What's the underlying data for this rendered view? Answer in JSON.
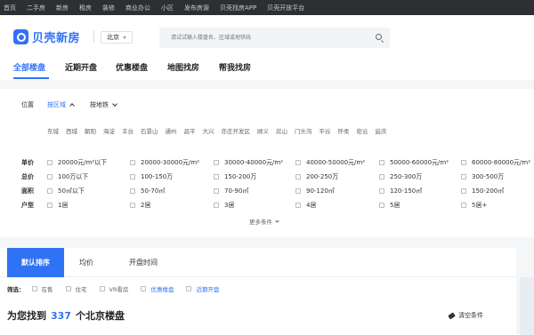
{
  "topbar": {
    "items": [
      "首页",
      "二手房",
      "新房",
      "租房",
      "装修",
      "商业办公",
      "小区",
      "发布房源",
      "贝壳找房APP",
      "贝壳开放平台"
    ]
  },
  "header": {
    "logo_text": "贝壳新房",
    "city": "北京",
    "search_placeholder": "请试试输入楼盘名、区域或地铁线"
  },
  "nav": {
    "items": [
      "全部楼盘",
      "近期开盘",
      "优惠楼盘",
      "地图找房",
      "帮我找房"
    ],
    "active_index": 0
  },
  "filter": {
    "position": {
      "label": "位置",
      "by_district": "按区域",
      "by_subway": "按地铁"
    },
    "districts": [
      "东城",
      "西城",
      "朝阳",
      "海淀",
      "丰台",
      "石景山",
      "通州",
      "昌平",
      "大兴",
      "亦庄开发区",
      "顺义",
      "房山",
      "门头沟",
      "平谷",
      "怀柔",
      "密云",
      "延庆"
    ],
    "unit_price": {
      "label": "单价",
      "options": [
        "20000元/m²以下",
        "20000-30000元/m²",
        "30000-40000元/m²",
        "40000-50000元/m²",
        "50000-60000元/m²",
        "60000-80000元/m²"
      ]
    },
    "total_price": {
      "label": "总价",
      "options": [
        "100万以下",
        "100-150万",
        "150-200万",
        "200-250万",
        "250-300万",
        "300-500万"
      ]
    },
    "area": {
      "label": "面积",
      "options": [
        "50㎡以下",
        "50-70㎡",
        "70-90㎡",
        "90-120㎡",
        "120-150㎡",
        "150-200㎡"
      ]
    },
    "layout": {
      "label": "户型",
      "options": [
        "1居",
        "2居",
        "3居",
        "4居",
        "5居",
        "5居+"
      ]
    },
    "more": "更多条件"
  },
  "sort": {
    "tabs": [
      "默认排序",
      "均价",
      "开盘时间"
    ],
    "active_index": 0
  },
  "screen": {
    "label": "筛选：",
    "options": [
      {
        "label": "在售",
        "highlight": false
      },
      {
        "label": "住宅",
        "highlight": false
      },
      {
        "label": "VR看房",
        "highlight": false
      },
      {
        "label": "优惠楼盘",
        "highlight": true
      },
      {
        "label": "近期开盘",
        "highlight": true
      }
    ]
  },
  "result": {
    "prefix": "为您找到",
    "count": "337",
    "suffix": "个北京楼盘",
    "clear_label": "清空条件"
  },
  "colors": {
    "accent": "#3072f6",
    "topbar_bg": "#2d2f33"
  }
}
